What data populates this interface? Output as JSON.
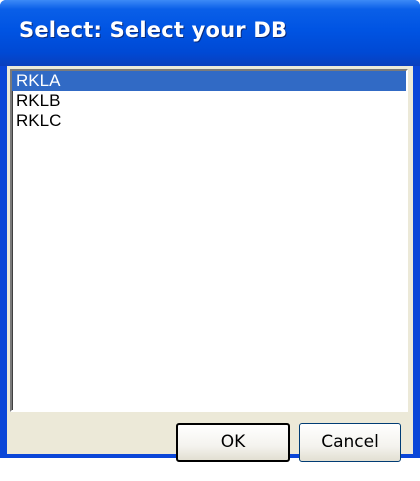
{
  "dialog": {
    "title": "Select: Select your DB"
  },
  "list": {
    "items": [
      "RKLA",
      "RKLB",
      "RKLC"
    ],
    "selected_index": 0
  },
  "buttons": {
    "ok_label": "OK",
    "cancel_label": "Cancel"
  },
  "colors": {
    "titlebar": "#0054e3",
    "selection": "#316ac5",
    "dialog_face": "#ece9d8"
  }
}
